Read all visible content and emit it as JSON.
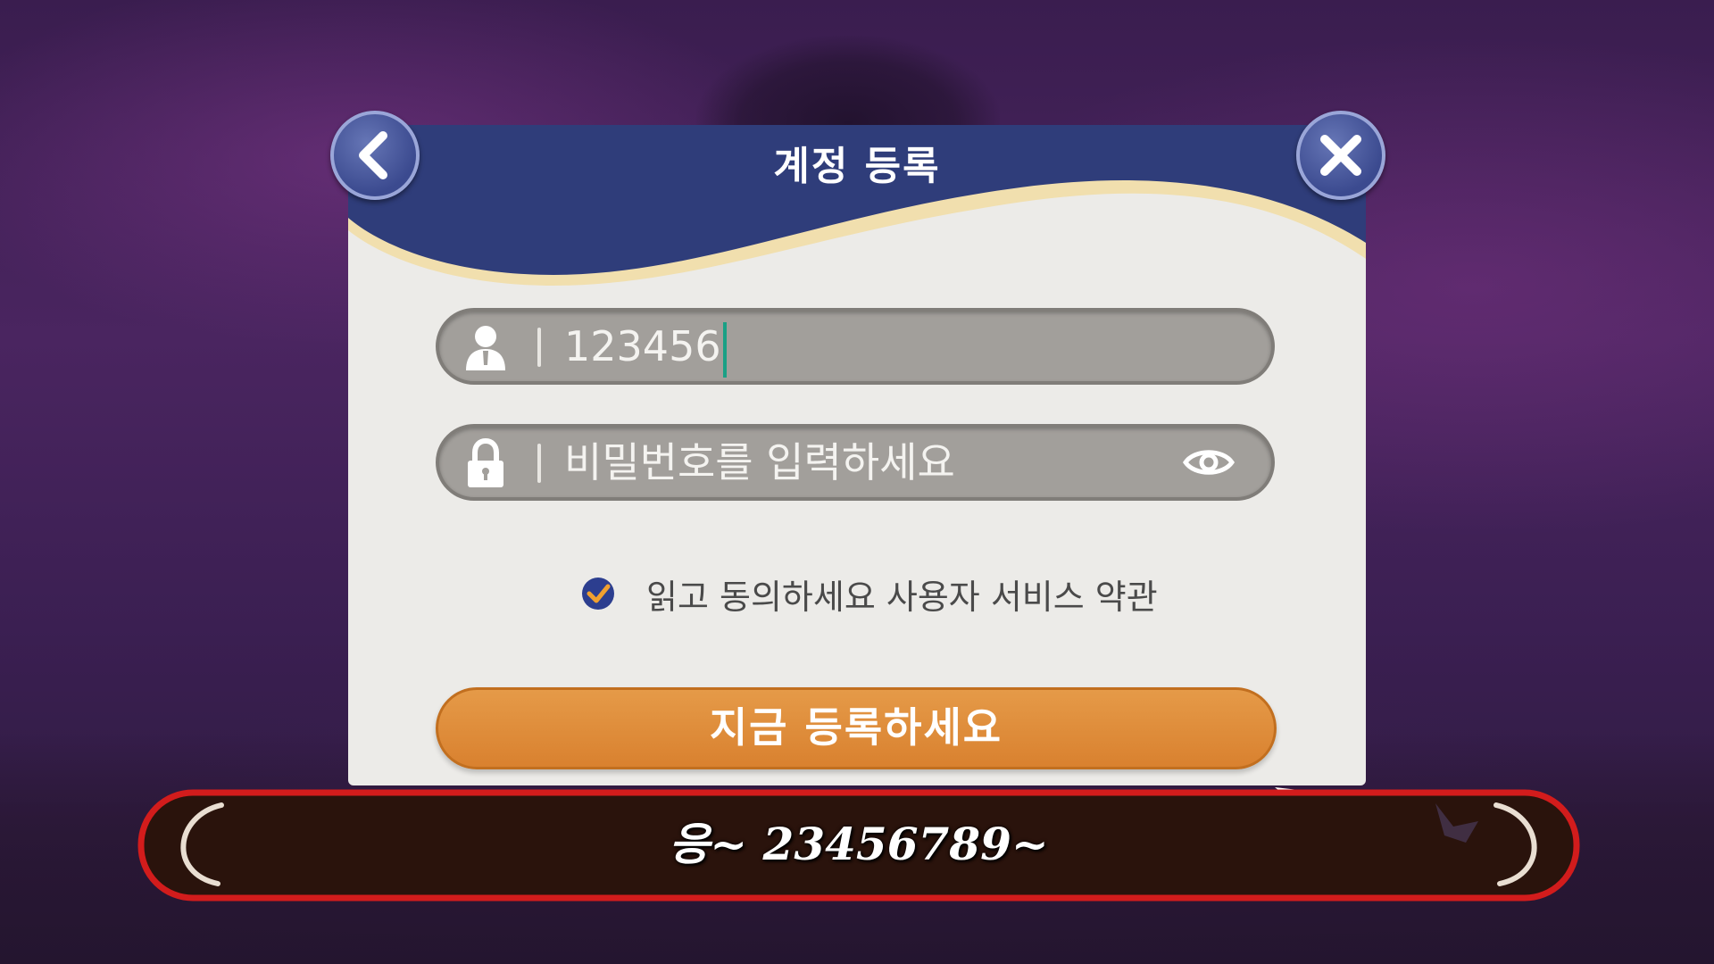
{
  "dialog": {
    "title": "계정 등록",
    "back_icon": "chevron-left-icon",
    "close_icon": "close-icon"
  },
  "username_field": {
    "value": "123456",
    "icon": "user-icon"
  },
  "password_field": {
    "placeholder": "비밀번호를  입력하세요",
    "icon": "lock-icon",
    "toggle_icon": "eye-icon"
  },
  "terms": {
    "checked": true,
    "label": "읽고 동의하세요 사용자 서비스 약관"
  },
  "submit_label": "지금 등록하세요",
  "subtitle": "응~ 23456789~",
  "colors": {
    "header_navy": "#2f3d7a",
    "accent_cream": "#f1dfae",
    "button_orange": "#df8a3a",
    "check_blue": "#2c3e8f",
    "banner_red": "#d21c1c",
    "banner_fill": "#2a130c"
  }
}
